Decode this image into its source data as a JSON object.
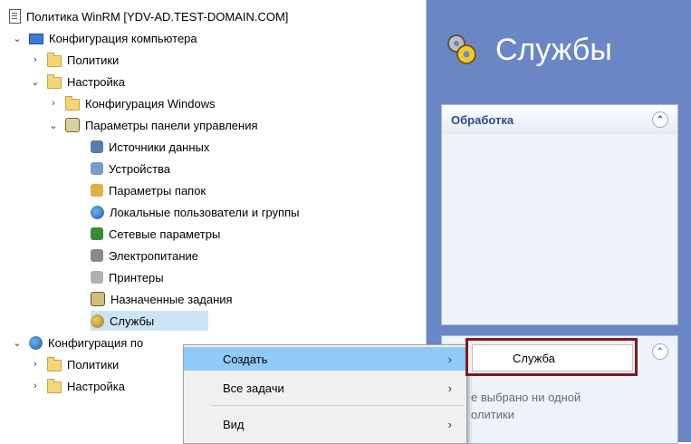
{
  "tree": {
    "root_label": "Политика WinRM [YDV-AD.TEST-DOMAIN.COM]",
    "computer_config": "Конфигурация компьютера",
    "policies": "Политики",
    "settings": "Настройка",
    "windows_config": "Конфигурация Windows",
    "control_panel": "Параметры панели управления",
    "data_sources": "Источники данных",
    "devices": "Устройства",
    "folder_options": "Параметры папок",
    "local_users": "Локальные пользователи и группы",
    "network": "Сетевые параметры",
    "power": "Электропитание",
    "printers": "Принтеры",
    "scheduled_tasks": "Назначенные задания",
    "services": "Службы",
    "user_config": "Конфигурация по",
    "user_policies": "Политики",
    "user_settings": "Настройка"
  },
  "panel": {
    "title": "Службы",
    "section_processing": "Обработка",
    "no_policy_msg": "е выбрано ни одной\nолитики"
  },
  "context_menu": {
    "create": "Создать",
    "all_tasks": "Все задачи",
    "view": "Вид"
  },
  "submenu": {
    "service": "Служба"
  }
}
